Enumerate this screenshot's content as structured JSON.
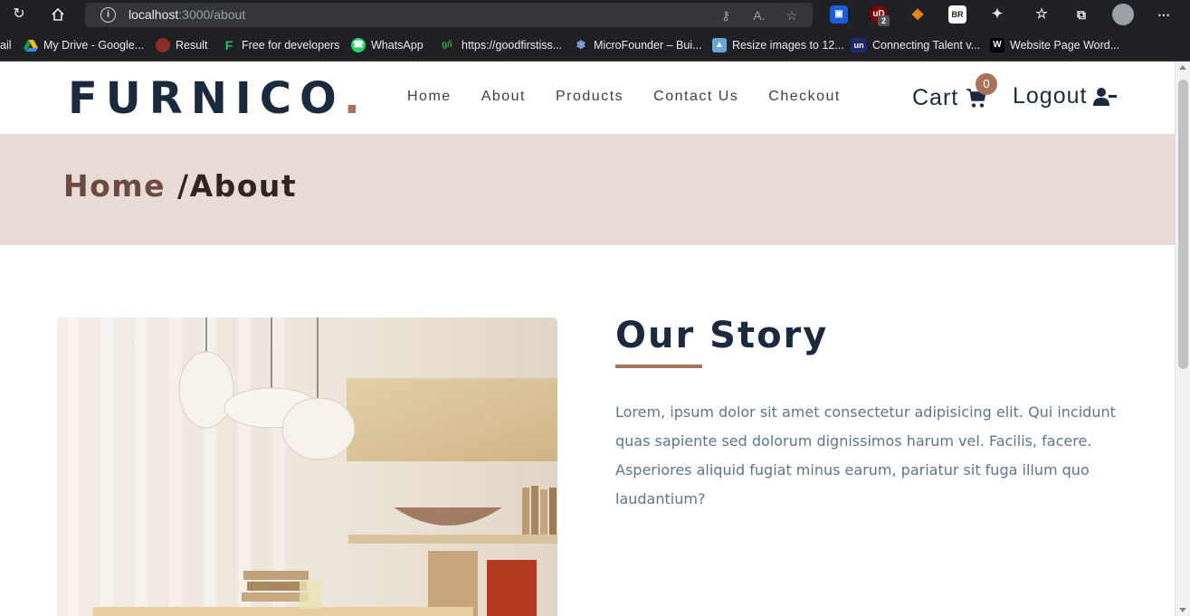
{
  "browser": {
    "url_host": "localhost",
    "url_path": ":3000/about",
    "bookmarks": [
      {
        "label": "ail"
      },
      {
        "label": "My Drive - Google..."
      },
      {
        "label": "Result"
      },
      {
        "label": "Free for developers"
      },
      {
        "label": "WhatsApp"
      },
      {
        "label": "https://goodfirstiss..."
      },
      {
        "label": "MicroFounder – Bui..."
      },
      {
        "label": "Resize images to 12..."
      },
      {
        "label": "Connecting Talent v..."
      },
      {
        "label": "Website Page Word..."
      }
    ],
    "bookmark_favicons": [
      "",
      "",
      "",
      "F",
      "",
      "g/i",
      "",
      "",
      "un",
      "W"
    ],
    "ext_ublock_count": "2"
  },
  "nav": {
    "logo": "FURNICO",
    "logo_dot": ".",
    "links": [
      "Home",
      "About",
      "Products",
      "Contact Us",
      "Checkout"
    ],
    "cart_label": "Cart",
    "cart_count": "0",
    "logout_label": "Logout"
  },
  "breadcrumb": {
    "home": "Home",
    "current": " /About"
  },
  "story": {
    "title": "Our Story",
    "body": "Lorem, ipsum dolor sit amet consectetur adipisicing elit. Qui incidunt quas sapiente sed dolorum dignissimos harum vel. Facilis, facere. Asperiores aliquid fugiat minus earum, pariatur sit fuga illum quo laudantium?"
  },
  "colors": {
    "brand_dark": "#1b2a3e",
    "accent": "#a7735a",
    "band": "#e8dbd5"
  }
}
